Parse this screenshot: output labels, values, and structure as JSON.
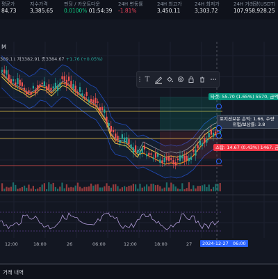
{
  "stats": [
    {
      "label": "평균가",
      "value": "84.73",
      "tone": "normal"
    },
    {
      "label": "지수가격",
      "value": "3,385.65",
      "tone": "normal"
    },
    {
      "label": "펀딩 / 카운트다운",
      "value_a": "0.0100%",
      "value_b": "01:54:39"
    },
    {
      "label": "24H 변동률",
      "value": "-1.81%",
      "tone": "down"
    },
    {
      "label": "24H 최고가",
      "value": "3,450.11",
      "tone": "normal"
    },
    {
      "label": "24H 최저가",
      "value": "3,303.72",
      "tone": "normal"
    },
    {
      "label": "24H 거래량(USDT)",
      "value": "107,958,928.25",
      "tone": "normal"
    }
  ],
  "chart": {
    "interval_label": "M",
    "legend_text_a": "389.11 저3382.91 종3384.67",
    "legend_change": "+1.76 (+0.05%)"
  },
  "toolbar": {
    "text_tool_icon": "T",
    "buttons": [
      "text-icon",
      "pen-icon",
      "fill-icon",
      "settings-icon",
      "lock-icon",
      "delete-icon",
      "more-icon"
    ]
  },
  "tags": {
    "take_profit": "타겟: 55.70 (1.65%) 5570, 금액",
    "position_line1": "포지션보유 손익: 1.66, 수량",
    "position_line2": "위험/보상률: 3.8",
    "stop_loss": "스탑: 14.67 (0.43%) 1467, 금액"
  },
  "time_axis": {
    "ticks": [
      "12:00",
      "18:00",
      "26",
      "06:00",
      "12:00",
      "18:00",
      "27"
    ],
    "highlight": "2024-12-27",
    "highlight_time": "06:00"
  },
  "bottom_panel": {
    "title": "거래 내역"
  },
  "colors": {
    "bg": "#131722",
    "up": "#26a69a",
    "down": "#ef5350",
    "accent": "#2962ff",
    "ma_orange": "#f7931a",
    "ma_yellow": "#e8c547"
  }
}
